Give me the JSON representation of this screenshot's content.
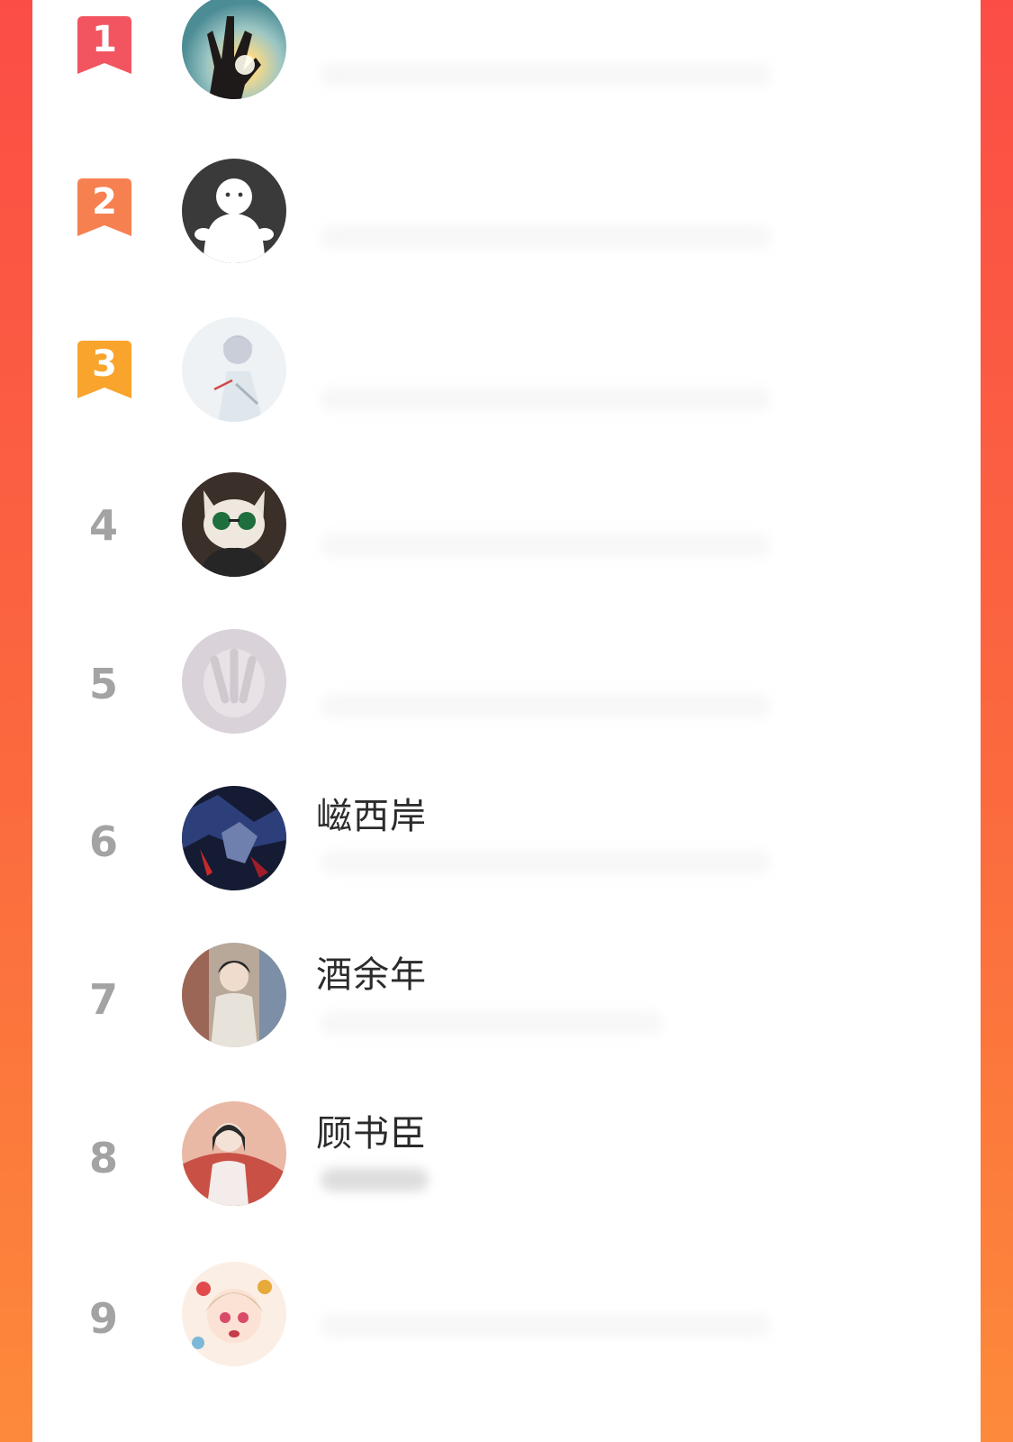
{
  "colors": {
    "background_top": "#fb4d46",
    "background_bottom": "#fd8a3a",
    "rank_1": "#f25560",
    "rank_2": "#f6804f",
    "rank_3": "#f9a42c",
    "rank_other": "#a3a3a3"
  },
  "ranking": {
    "entries": [
      {
        "rank": "1",
        "name": "",
        "avatar_icon": "hand-ok-gesture-avatar"
      },
      {
        "rank": "2",
        "name": "",
        "avatar_icon": "default-user-avatar"
      },
      {
        "rank": "3",
        "name": "",
        "avatar_icon": "anime-character-avatar"
      },
      {
        "rank": "4",
        "name": "",
        "avatar_icon": "cat-with-sunglasses-avatar"
      },
      {
        "rank": "5",
        "name": "",
        "avatar_icon": "blurred-hand-avatar"
      },
      {
        "rank": "6",
        "name": "嵫西岸",
        "avatar_icon": "dark-anime-avatar"
      },
      {
        "rank": "7",
        "name": "酒余年",
        "avatar_icon": "anime-boy-avatar"
      },
      {
        "rank": "8",
        "name": "顾书臣",
        "avatar_icon": "anime-girl-red-avatar"
      },
      {
        "rank": "9",
        "name": "",
        "avatar_icon": "anime-girl-flowers-avatar"
      }
    ]
  }
}
